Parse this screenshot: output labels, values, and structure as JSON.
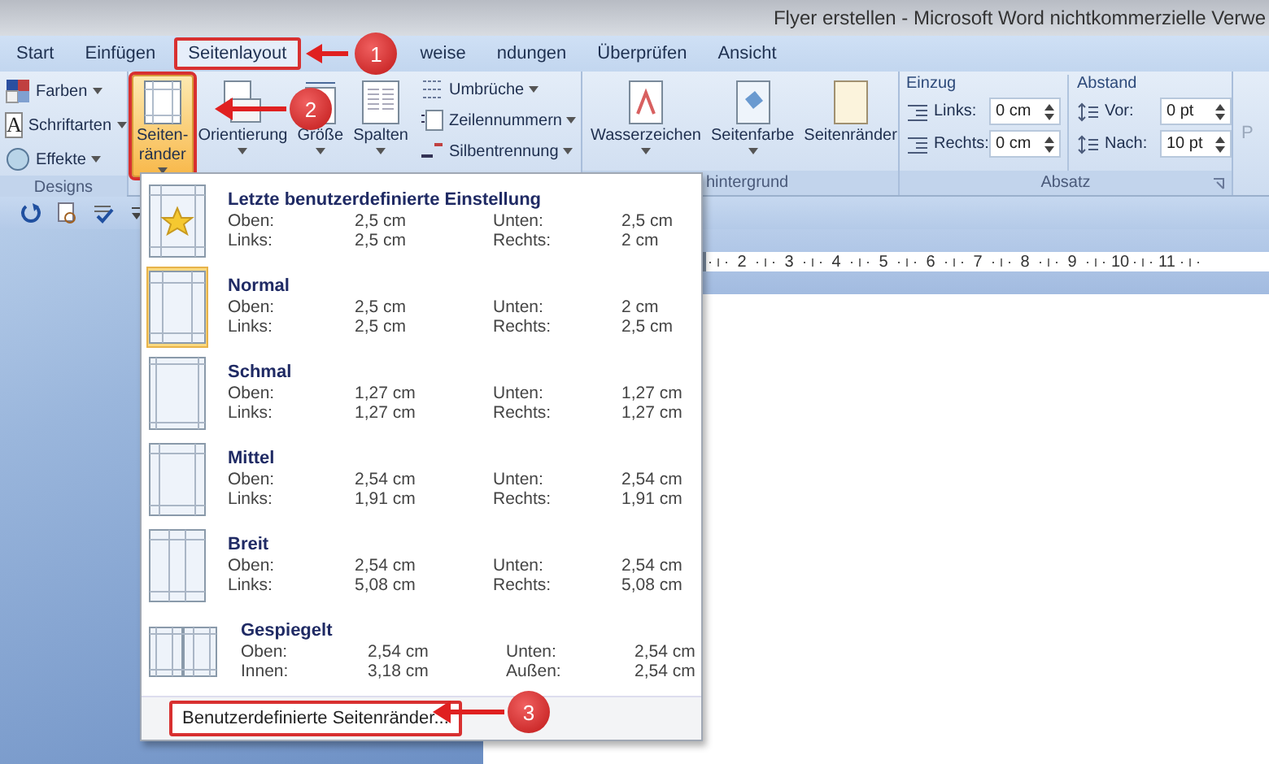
{
  "window": {
    "title": "Flyer erstellen - Microsoft Word nichtkommerzielle Verwe"
  },
  "tabs": [
    {
      "label": "Start",
      "selected": false,
      "marked": false
    },
    {
      "label": "Einfügen",
      "selected": false,
      "marked": false
    },
    {
      "label": "Seitenlayout",
      "selected": true,
      "marked": true
    },
    {
      "label": "weise",
      "selected": false,
      "marked": false
    },
    {
      "label": "ndungen",
      "selected": false,
      "marked": false
    },
    {
      "label": "Überprüfen",
      "selected": false,
      "marked": false
    },
    {
      "label": "Ansicht",
      "selected": false,
      "marked": false
    }
  ],
  "callouts": [
    "1",
    "2",
    "3"
  ],
  "designs": {
    "title": "Designs",
    "items": [
      {
        "label": "Farben"
      },
      {
        "label": "Schriftarten",
        "glyph": "A"
      },
      {
        "label": "Effekte"
      }
    ]
  },
  "page_setup": {
    "buttons": [
      {
        "label": "Seiten-\nränder",
        "dropdown": true,
        "selected": true,
        "marked": true
      },
      {
        "label": "Orientierung",
        "dropdown": true,
        "selected": false,
        "marked": false
      },
      {
        "label": "Größe",
        "dropdown": true,
        "selected": false,
        "marked": false
      },
      {
        "label": "Spalten",
        "dropdown": true,
        "selected": false,
        "marked": false
      }
    ],
    "small": [
      {
        "label": "Umbrüche"
      },
      {
        "label": "Zeilennummern"
      },
      {
        "label": "Silbentrennung"
      }
    ]
  },
  "background": {
    "title": "hintergrund",
    "buttons": [
      {
        "label": "Wasserzeichen",
        "dropdown": true
      },
      {
        "label": "Seitenfarbe",
        "dropdown": true
      },
      {
        "label": "Seitenränder",
        "dropdown": false
      }
    ]
  },
  "paragraph": {
    "title": "Absatz",
    "groups": [
      {
        "title": "Einzug",
        "fields": [
          {
            "label": "Links:",
            "value": "0 cm"
          },
          {
            "label": "Rechts:",
            "value": "0 cm"
          }
        ]
      },
      {
        "title": "Abstand",
        "fields": [
          {
            "label": "Vor:",
            "value": "0 pt"
          },
          {
            "label": "Nach:",
            "value": "10 pt"
          }
        ]
      }
    ]
  },
  "next_group": {
    "label": "P"
  },
  "ruler": [
    "2",
    "3",
    "4",
    "5",
    "6",
    "7",
    "8",
    "9",
    "10",
    "11"
  ],
  "margins_menu": {
    "items": [
      {
        "name": "Letzte benutzerdefinierte Einstellung",
        "selected": false,
        "rows": [
          [
            "Oben:",
            "2,5 cm",
            "Unten:",
            "2,5 cm"
          ],
          [
            "Links:",
            "2,5 cm",
            "Rechts:",
            "2 cm"
          ]
        ]
      },
      {
        "name": "Normal",
        "selected": true,
        "rows": [
          [
            "Oben:",
            "2,5 cm",
            "Unten:",
            "2 cm"
          ],
          [
            "Links:",
            "2,5 cm",
            "Rechts:",
            "2,5 cm"
          ]
        ]
      },
      {
        "name": "Schmal",
        "selected": false,
        "rows": [
          [
            "Oben:",
            "1,27 cm",
            "Unten:",
            "1,27 cm"
          ],
          [
            "Links:",
            "1,27 cm",
            "Rechts:",
            "1,27 cm"
          ]
        ]
      },
      {
        "name": "Mittel",
        "selected": false,
        "rows": [
          [
            "Oben:",
            "2,54 cm",
            "Unten:",
            "2,54 cm"
          ],
          [
            "Links:",
            "1,91 cm",
            "Rechts:",
            "1,91 cm"
          ]
        ]
      },
      {
        "name": "Breit",
        "selected": false,
        "rows": [
          [
            "Oben:",
            "2,54 cm",
            "Unten:",
            "2,54 cm"
          ],
          [
            "Links:",
            "5,08 cm",
            "Rechts:",
            "5,08 cm"
          ]
        ]
      },
      {
        "name": "Gespiegelt",
        "selected": false,
        "rows": [
          [
            "Oben:",
            "2,54 cm",
            "Unten:",
            "2,54 cm"
          ],
          [
            "Innen:",
            "3,18 cm",
            "Außen:",
            "2,54 cm"
          ]
        ]
      }
    ],
    "footer": {
      "label": "Benutzerdefinierte Seitenränder...",
      "marked": true
    }
  }
}
